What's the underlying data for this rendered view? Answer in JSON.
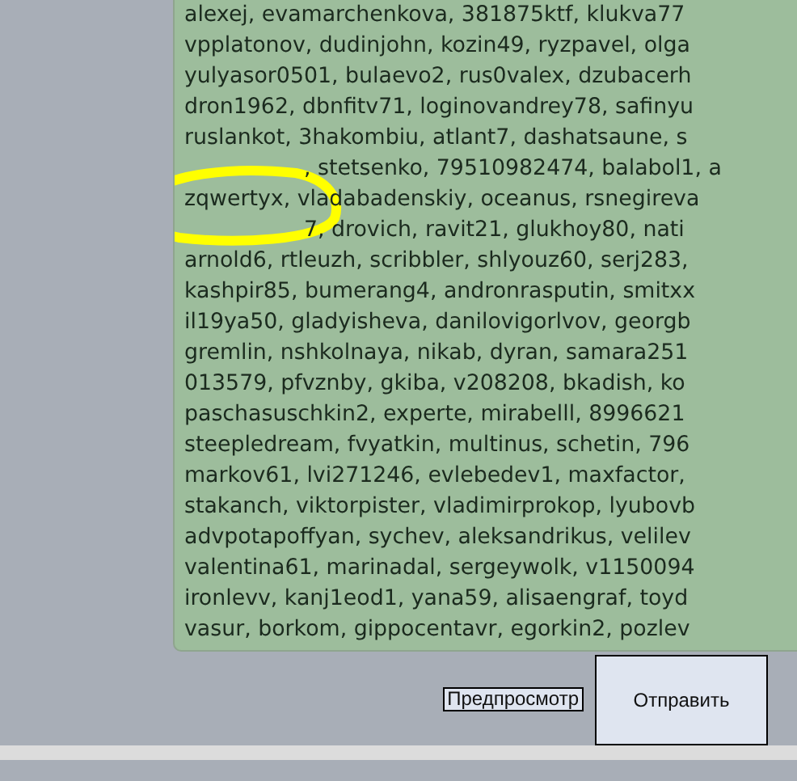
{
  "message_box": {
    "lines": [
      {
        "kind": "full",
        "text": "alexej, evamarchenkova, 381875ktf, klukva77"
      },
      {
        "kind": "full",
        "text": "vpplatonov, dudinjohn, kozin49, ryzpavel, olga"
      },
      {
        "kind": "full",
        "text": "yulyasor0501, bulaevo2, rus0valex, dzubacerh"
      },
      {
        "kind": "full",
        "text": "dron1962, dbnfitv71, loginovandrey78, safinyu"
      },
      {
        "kind": "full",
        "text": "ruslankot, 3hakombiu, atlant7, dashatsaune, s"
      },
      {
        "kind": "covered",
        "text": ", stetsenko, 79510982474, balabol1, a"
      },
      {
        "kind": "full",
        "text": "zqwertyx, vladabadenskiy, oceanus, rsnegireva"
      },
      {
        "kind": "covered",
        "text": "7, drovich, ravit21, glukhoy80, nati"
      },
      {
        "kind": "full",
        "text": "arnold6, rtleuzh, scribbler, shlyouz60, serj283,"
      },
      {
        "kind": "full",
        "text": "kashpir85, bumerang4, andronrasputin, smitxx"
      },
      {
        "kind": "full",
        "text": "il19ya50, gladyisheva, danilovigorlvov, georgb"
      },
      {
        "kind": "full",
        "text": "gremlin, nshkolnaya, nikab, dyran, samara251"
      },
      {
        "kind": "full",
        "text": "013579, pfvznby, gkiba, v208208, bkadish, ko"
      },
      {
        "kind": "full",
        "text": "paschasuschkin2, experte, mirabelll, 8996621"
      },
      {
        "kind": "full",
        "text": "steepledream, fvyatkin, multinus, schetin, 796"
      },
      {
        "kind": "full",
        "text": "markov61, lvi271246, evlebedev1, maxfactor,"
      },
      {
        "kind": "full",
        "text": "stakanch, viktorpister, vladimirprokop, lyubovb"
      },
      {
        "kind": "full",
        "text": "advpotapoffyan, sychev, aleksandrikus, velilev"
      },
      {
        "kind": "full",
        "text": "valentina61, marinadal, sergeywolk, v1150094"
      },
      {
        "kind": "full",
        "text": "ironlevv, kanj1eod1, yana59, alisaengraf, toyd"
      },
      {
        "kind": "full",
        "text": "vasur, borkom, gippocentavr, egorkin2, pozlev"
      }
    ]
  },
  "buttons": {
    "preview": "Предпросмотр",
    "submit": "Отправить"
  }
}
